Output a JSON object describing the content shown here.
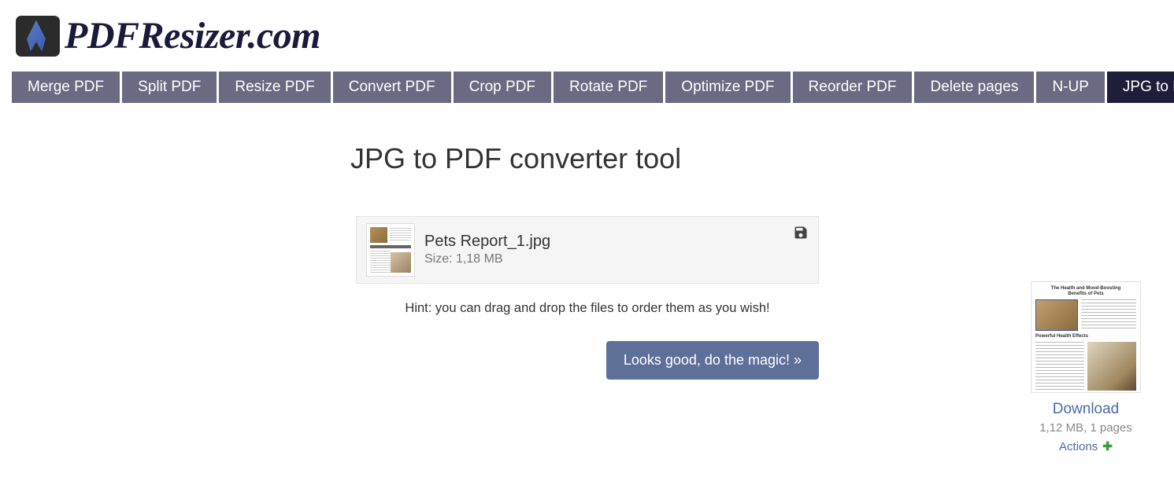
{
  "logo": {
    "text": "PDFResizer.com"
  },
  "nav": {
    "items": [
      {
        "label": "Merge PDF",
        "active": false
      },
      {
        "label": "Split PDF",
        "active": false
      },
      {
        "label": "Resize PDF",
        "active": false
      },
      {
        "label": "Convert PDF",
        "active": false
      },
      {
        "label": "Crop PDF",
        "active": false
      },
      {
        "label": "Rotate PDF",
        "active": false
      },
      {
        "label": "Optimize PDF",
        "active": false
      },
      {
        "label": "Reorder PDF",
        "active": false
      },
      {
        "label": "Delete pages",
        "active": false
      },
      {
        "label": "N-UP",
        "active": false
      },
      {
        "label": "JPG to PDF",
        "active": true
      }
    ]
  },
  "page": {
    "title": "JPG to PDF converter tool"
  },
  "file": {
    "name": "Pets Report_1.jpg",
    "size_label": "Size: 1,18 MB"
  },
  "hint": "Hint: you can drag and drop the files to order them as you wish!",
  "action_button": "Looks good, do the magic! »",
  "preview": {
    "title_line1": "The Health and Mood-Boosting",
    "title_line2": "Benefits of Pets",
    "heading": "Powerful Health Effects"
  },
  "download": {
    "link": "Download",
    "meta": "1,12 MB, 1 pages",
    "actions": "Actions"
  }
}
